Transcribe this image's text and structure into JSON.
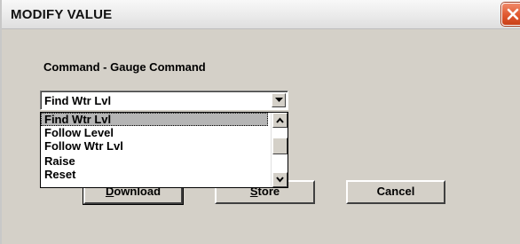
{
  "window": {
    "title": "MODIFY VALUE",
    "close_icon": "close-icon",
    "accent_close": "#e0582f"
  },
  "form": {
    "command_label": "Command - Gauge Command",
    "selected_value": "Find Wtr Lvl"
  },
  "dropdown": {
    "items": [
      {
        "label": "Find Wtr Lvl",
        "selected": true
      },
      {
        "label": "Follow Level",
        "selected": false
      },
      {
        "label": "Follow Wtr Lvl",
        "selected": false
      },
      {
        "label": "Raise",
        "selected": false
      },
      {
        "label": "Reset",
        "selected": false
      }
    ],
    "scroll_up_icon": "chevron-up-icon",
    "scroll_down_icon": "chevron-down-icon"
  },
  "buttons": {
    "download_mnemonic": "D",
    "download_rest": "ownload",
    "store_mnemonic": "S",
    "store_rest": "tore",
    "cancel": "Cancel"
  }
}
